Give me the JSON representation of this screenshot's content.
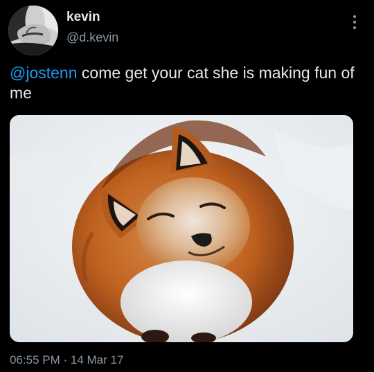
{
  "tweet": {
    "author": {
      "display_name": "kevin",
      "handle": "@d.kevin"
    },
    "text": {
      "mention": "@jostenn",
      "body": " come get your cat she is making fun of me"
    },
    "timestamp": {
      "time": "06:55 PM",
      "separator": " · ",
      "date": "14 Mar 17"
    }
  },
  "colors": {
    "background": "#000000",
    "primary_text": "#e7e9ea",
    "secondary_text": "#8b98a5",
    "mention": "#1d9bf0"
  },
  "icons": {
    "more": "more-vertical-icon"
  }
}
